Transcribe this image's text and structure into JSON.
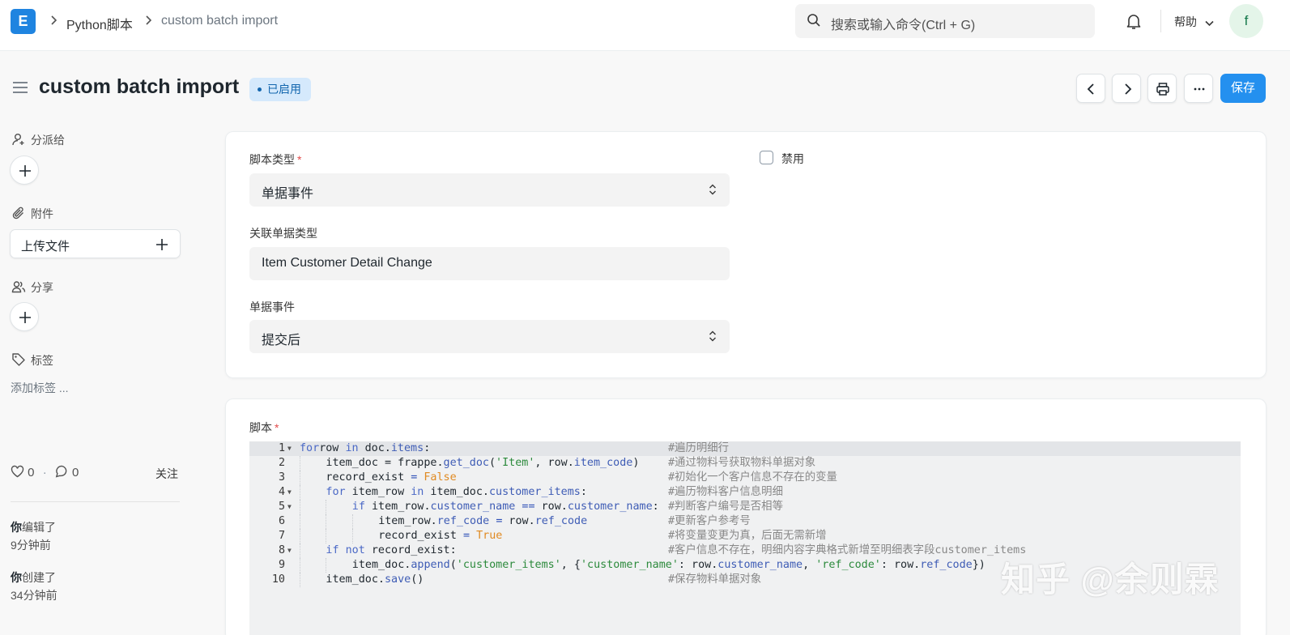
{
  "nav": {
    "logo_letter": "E",
    "breadcrumbs": [
      "Python脚本",
      "custom batch import"
    ],
    "search_placeholder": "搜索或输入命令(Ctrl + G)",
    "help_label": "帮助",
    "avatar_letter": "f"
  },
  "page": {
    "title": "custom batch import",
    "status": "已启用",
    "save_label": "保存"
  },
  "sidebar": {
    "assign_label": "分派给",
    "attachments_label": "附件",
    "upload_label": "上传文件",
    "share_label": "分享",
    "tags_label": "标签",
    "add_tag_label": "添加标签 ...",
    "likes": "0",
    "comments": "0",
    "follow_label": "关注",
    "activity": [
      {
        "who": "你",
        "action": "编辑了",
        "time": "9分钟前"
      },
      {
        "who": "你",
        "action": "创建了",
        "time": "34分钟前"
      }
    ]
  },
  "form": {
    "script_type": {
      "label": "脚本类型",
      "value": "单据事件"
    },
    "disabled": {
      "label": "禁用",
      "checked": false
    },
    "doctype": {
      "label": "关联单据类型",
      "value": "Item Customer Detail Change"
    },
    "doc_event": {
      "label": "单据事件",
      "value": "提交后"
    },
    "script_label": "脚本"
  },
  "code": {
    "lines": [
      {
        "n": "1",
        "fold": true,
        "indent": 0,
        "tokens": [
          [
            "kw",
            "for"
          ],
          [
            "",
            "row "
          ],
          [
            "kw",
            "in"
          ],
          [
            "",
            " doc."
          ],
          [
            "attr",
            "items"
          ],
          [
            "",
            ":"
          ]
        ],
        "comment": "#遍历明细行"
      },
      {
        "n": "2",
        "fold": false,
        "indent": 1,
        "tokens": [
          [
            "",
            "item_doc = frappe."
          ],
          [
            "attr",
            "get_doc"
          ],
          [
            "",
            "("
          ],
          [
            "str",
            "'Item'"
          ],
          [
            "",
            ", row."
          ],
          [
            "attr",
            "item_code"
          ],
          [
            "",
            ")"
          ]
        ],
        "comment": "#通过物料号获取物料单据对象"
      },
      {
        "n": "3",
        "fold": false,
        "indent": 1,
        "tokens": [
          [
            "",
            "record_exist "
          ],
          [
            "op",
            "="
          ],
          [
            "",
            ""
          ],
          [
            "bool",
            " False"
          ]
        ],
        "comment": "#初始化一个客户信息不存在的变量"
      },
      {
        "n": "4",
        "fold": true,
        "indent": 1,
        "tokens": [
          [
            "kw",
            "for"
          ],
          [
            "",
            " item_row "
          ],
          [
            "kw",
            "in"
          ],
          [
            "",
            " item_doc."
          ],
          [
            "attr",
            "customer_items"
          ],
          [
            "",
            ":"
          ]
        ],
        "comment": "#遍历物料客户信息明细"
      },
      {
        "n": "5",
        "fold": true,
        "indent": 2,
        "tokens": [
          [
            "kw",
            "if"
          ],
          [
            "",
            " item_row."
          ],
          [
            "attr",
            "customer_name"
          ],
          [
            "",
            " "
          ],
          [
            "op",
            "=="
          ],
          [
            "",
            " row."
          ],
          [
            "attr",
            "customer_name"
          ],
          [
            "",
            ":"
          ]
        ],
        "comment": "#判断客户编号是否相等"
      },
      {
        "n": "6",
        "fold": false,
        "indent": 3,
        "tokens": [
          [
            "",
            "item_row."
          ],
          [
            "attr",
            "ref_code"
          ],
          [
            "",
            " "
          ],
          [
            "op",
            "="
          ],
          [
            "",
            " row."
          ],
          [
            "attr",
            "ref_code"
          ]
        ],
        "comment": "#更新客户参考号"
      },
      {
        "n": "7",
        "fold": false,
        "indent": 3,
        "tokens": [
          [
            "",
            "record_exist "
          ],
          [
            "op",
            "="
          ],
          [
            "bool",
            " True"
          ]
        ],
        "comment": "#将变量变更为真，后面无需新增"
      },
      {
        "n": "8",
        "fold": true,
        "indent": 1,
        "tokens": [
          [
            "kw",
            "if"
          ],
          [
            "",
            " "
          ],
          [
            "kw",
            "not"
          ],
          [
            "",
            " record_exist:"
          ]
        ],
        "comment": "#客户信息不存在，明细内容字典格式新增至明细表字段customer_items"
      },
      {
        "n": "9",
        "fold": false,
        "indent": 2,
        "tokens": [
          [
            "",
            "item_doc."
          ],
          [
            "attr",
            "append"
          ],
          [
            "",
            "("
          ],
          [
            "str",
            "'customer_items'"
          ],
          [
            "",
            ", {"
          ],
          [
            "str",
            "'customer_name'"
          ],
          [
            "",
            ": row."
          ],
          [
            "attr",
            "customer_name"
          ],
          [
            "",
            ", "
          ],
          [
            "str",
            "'ref_code'"
          ],
          [
            "",
            ": row."
          ],
          [
            "attr",
            "ref_code"
          ],
          [
            "",
            "})"
          ]
        ],
        "comment": ""
      },
      {
        "n": "10",
        "fold": false,
        "indent": 1,
        "tokens": [
          [
            "",
            "item_doc."
          ],
          [
            "attr",
            "save"
          ],
          [
            "",
            "()"
          ]
        ],
        "comment": "#保存物料单据对象"
      }
    ]
  },
  "watermark": "知乎 @余则霖"
}
